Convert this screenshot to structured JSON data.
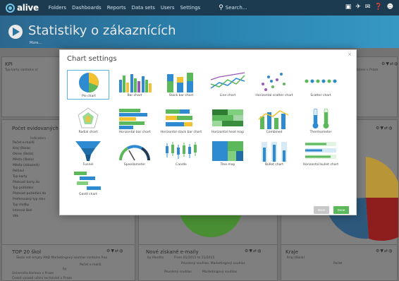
{
  "topbar": {
    "logo": "alive",
    "nav": [
      "Folders",
      "Dashboards",
      "Reports",
      "Data sets",
      "Users",
      "Settings"
    ],
    "search_placeholder": "Search..."
  },
  "header": {
    "title": "Statistiky o zákaznících",
    "more": "More..."
  },
  "panels": {
    "kpi": {
      "title": "KPI",
      "filter": "Typ karty contains st",
      "filter_right": "Aktivní v Praze"
    },
    "pocet": {
      "title": "Počet evidovaných",
      "indicators": "Indicators",
      "items": [
        "Počet e-mailů",
        "Kraj (škola)",
        "Okres (škola)",
        "Město (škola)",
        "Město (zákazník)",
        "Pohlaví",
        "Typ karty",
        "Platnost karty do",
        "Typ požádání",
        "Platnost požádání do",
        "Preferovaný typ slev",
        "Typ služby",
        "Interval škol",
        "Věk"
      ]
    },
    "top20": {
      "title": "TOP 20 škol",
      "filter": "Škola not empty AND Marketingový souhlas contains Ano",
      "col_header": "Počet e-mailů",
      "col_by": "by",
      "rows": [
        "Univerzita Karlova v Praze",
        "České vysoké učení technické v Praze"
      ]
    },
    "nove": {
      "title": "Nové získané e-maily",
      "by": "by Months",
      "range": "From 01/2015 to 11/2015",
      "subtitle": "Povolený souhlas, Marketingový souhlas",
      "legend1": "Povolený souhlas",
      "legend2": "Marketingový souhlas"
    },
    "kraje": {
      "title": "Kraje",
      "by": "Kraj (škola)",
      "metric": "Počet"
    }
  },
  "modal": {
    "title": "Chart settings",
    "close": "×",
    "charts": [
      {
        "label": "Pie chart",
        "icon": "pie-chart-icon"
      },
      {
        "label": "Bar chart",
        "icon": "bar-chart-icon"
      },
      {
        "label": "Stack bar chart",
        "icon": "stack-bar-chart-icon"
      },
      {
        "label": "Line chart",
        "icon": "line-chart-icon"
      },
      {
        "label": "Horizontal scatter chart",
        "icon": "horizontal-scatter-chart-icon"
      },
      {
        "label": "Scatter chart",
        "icon": "scatter-chart-icon"
      },
      {
        "label": "Radial chart",
        "icon": "radial-chart-icon"
      },
      {
        "label": "Horizontal bar chart",
        "icon": "horizontal-bar-chart-icon"
      },
      {
        "label": "Horizontal stack bar chart",
        "icon": "horizontal-stack-bar-chart-icon"
      },
      {
        "label": "Horizontal heat map",
        "icon": "horizontal-heat-map-icon"
      },
      {
        "label": "Combined",
        "icon": "combined-chart-icon"
      },
      {
        "label": "Thermometer",
        "icon": "thermometer-icon"
      },
      {
        "label": "Funnel",
        "icon": "funnel-chart-icon"
      },
      {
        "label": "Speedometer",
        "icon": "speedometer-icon"
      },
      {
        "label": "Candle",
        "icon": "candle-chart-icon"
      },
      {
        "label": "Tree map",
        "icon": "tree-map-icon"
      },
      {
        "label": "Bullet chart",
        "icon": "bullet-chart-icon"
      },
      {
        "label": "Horizontal bullet chart",
        "icon": "horizontal-bullet-chart-icon"
      },
      {
        "label": "Gantt chart",
        "icon": "gantt-chart-icon"
      }
    ],
    "back_label": "Back",
    "done_label": "Done"
  },
  "colors": {
    "nav": "#1d3b50",
    "header": "#2b8fc0",
    "accent_green": "#5bb85b",
    "selected_border": "#59b6e0"
  }
}
